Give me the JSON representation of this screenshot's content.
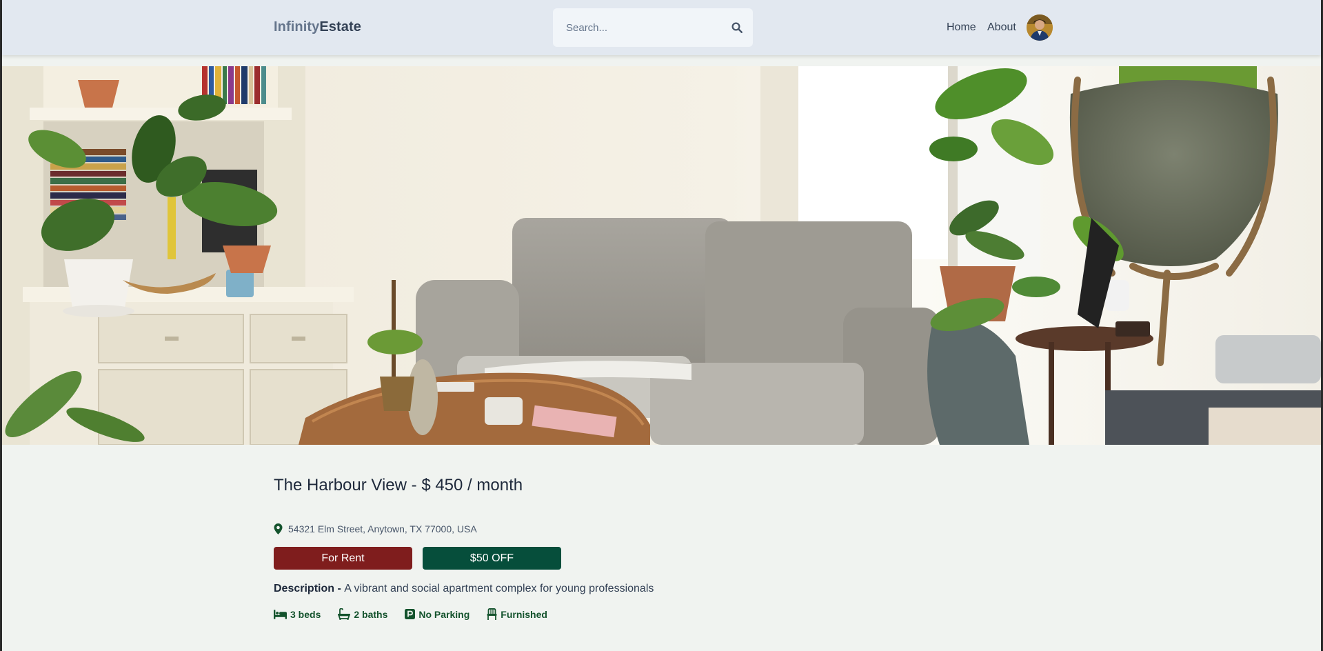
{
  "brand": {
    "part1": "Infinity",
    "part2": "Estate"
  },
  "search": {
    "placeholder": "Search..."
  },
  "nav": {
    "home": "Home",
    "about": "About"
  },
  "listing": {
    "title": "The Harbour View - $ 450 / month",
    "address": "54321 Elm Street, Anytown, TX 77000, USA",
    "type_badge": "For Rent",
    "discount_badge": "$50 OFF",
    "description_label": "Description - ",
    "description": "A vibrant and social apartment complex for young professionals",
    "features": {
      "beds": "3 beds",
      "baths": "2 baths",
      "parking": "No Parking",
      "furnished": "Furnished"
    }
  },
  "colors": {
    "header_bg": "#e2e8f0",
    "page_bg": "#f0f3f0",
    "rent_badge": "#7f1d1d",
    "offer_badge": "#064e3b",
    "feature_text": "#14532d"
  },
  "icons": [
    "search-icon",
    "location-pin-icon",
    "bed-icon",
    "bath-icon",
    "parking-icon",
    "chair-icon"
  ]
}
